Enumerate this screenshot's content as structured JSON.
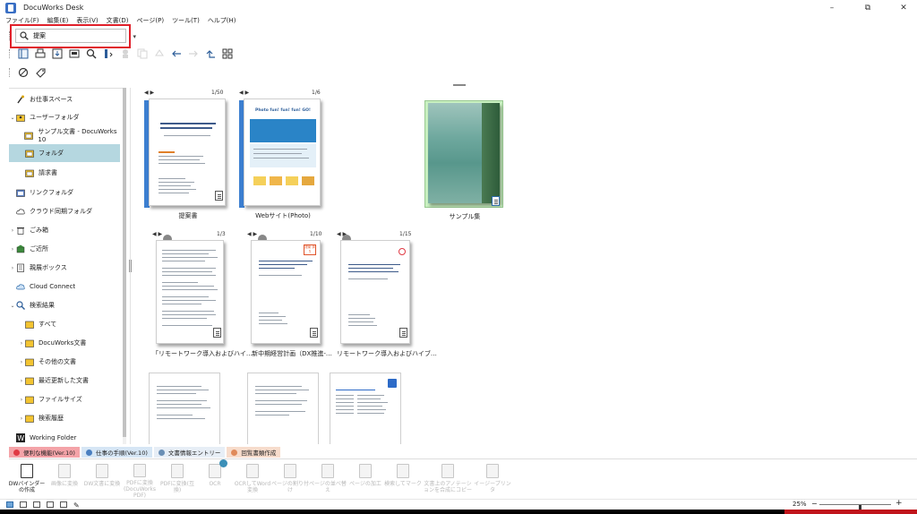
{
  "window": {
    "title": "DocuWorks Desk",
    "minimize": "–",
    "maximize": "⧉",
    "close": "✕"
  },
  "menu": [
    "ファイル(F)",
    "編集(E)",
    "表示(V)",
    "文書(D)",
    "ページ(P)",
    "ツール(T)",
    "ヘルプ(H)"
  ],
  "search": {
    "value": "提案"
  },
  "sidebar": {
    "items": [
      {
        "label": "お仕事スペース",
        "arrow": "",
        "icon": "workspace-icon"
      },
      {
        "label": "ユーザーフォルダ",
        "arrow": "⌄",
        "icon": "user-folder-icon"
      },
      {
        "label": "サンプル文書 - DocuWorks 10",
        "arrow": "",
        "icon": "folder-icon"
      },
      {
        "label": "フォルダ",
        "arrow": "",
        "icon": "folder-icon",
        "selected": true
      },
      {
        "label": "請求書",
        "arrow": "",
        "icon": "folder-icon"
      },
      {
        "label": "リンクフォルダ",
        "arrow": "",
        "icon": "link-folder-icon"
      },
      {
        "label": "クラウド同期フォルダ",
        "arrow": "",
        "icon": "cloud-icon"
      },
      {
        "label": "ごみ箱",
        "arrow": "›",
        "icon": "trash-icon"
      },
      {
        "label": "ご近所",
        "arrow": "›",
        "icon": "neighborhood-icon"
      },
      {
        "label": "親展ボックス",
        "arrow": "›",
        "icon": "confidential-box-icon"
      },
      {
        "label": "Cloud Connect",
        "arrow": "",
        "icon": "cloud-connect-icon"
      },
      {
        "label": "検索結果",
        "arrow": "⌄",
        "icon": "search-result-icon"
      },
      {
        "label": "すべて",
        "arrow": "",
        "icon": "folder-icon"
      },
      {
        "label": "DocuWorks文書",
        "arrow": "›",
        "icon": "folder-icon"
      },
      {
        "label": "その他の文書",
        "arrow": "›",
        "icon": "folder-icon"
      },
      {
        "label": "最近更新した文書",
        "arrow": "›",
        "icon": "folder-icon"
      },
      {
        "label": "ファイルサイズ",
        "arrow": "›",
        "icon": "folder-icon"
      },
      {
        "label": "検索履歴",
        "arrow": "›",
        "icon": "folder-icon"
      },
      {
        "label": "Working Folder",
        "arrow": "",
        "icon": "working-folder-icon"
      }
    ]
  },
  "documents": [
    {
      "label": "提案書",
      "page": "1/50"
    },
    {
      "label": "Webサイト(Photo)",
      "page": "1/6",
      "banner": "Photo fun! fun! fun! GO!"
    },
    {
      "label": "サンプル集",
      "page": ""
    },
    {
      "label": "「リモートワーク導入およびハイ…",
      "page": "1/3"
    },
    {
      "label": "新中期経営計画（DX推進-…",
      "page": "1/10",
      "stamp": "提案 済り"
    },
    {
      "label": "リモートワーク導入およびハイブ…",
      "page": "1/15"
    },
    {
      "label": "",
      "page": ""
    },
    {
      "label": "",
      "page": ""
    },
    {
      "label": "",
      "page": ""
    }
  ],
  "bottom_tabs": [
    {
      "label": "便利な機能(Ver.10)",
      "color": "#f4a3a8",
      "dot": "#e03a44"
    },
    {
      "label": "仕事の手順(Ver.10)",
      "color": "#d6e6f5",
      "dot": "#4a7fc0"
    },
    {
      "label": "文書情報エントリー",
      "color": "#e7eef6",
      "dot": "#6a8fb5"
    },
    {
      "label": "回覧書類作成",
      "color": "#f7dccc",
      "dot": "#e08a5a"
    }
  ],
  "ribbon": [
    {
      "label": "DWバインダーの作成",
      "active": true
    },
    {
      "label": "画像に変換"
    },
    {
      "label": "DW文書に変換"
    },
    {
      "label": "PDFに変換(DocuWorks PDF)"
    },
    {
      "label": "PDFに変換(互換)"
    },
    {
      "label": "OCR"
    },
    {
      "label": "OCRしてWord変換"
    },
    {
      "label": "ページの割り付け"
    },
    {
      "label": "ページの並べ替え"
    },
    {
      "label": "ページの加工"
    },
    {
      "label": "検索してマーク"
    },
    {
      "label": "文書上のアノテーションを合成にコピー"
    },
    {
      "label": "イージープリンタ"
    }
  ],
  "status": {
    "zoom": "25%",
    "zoom_level": 25
  }
}
